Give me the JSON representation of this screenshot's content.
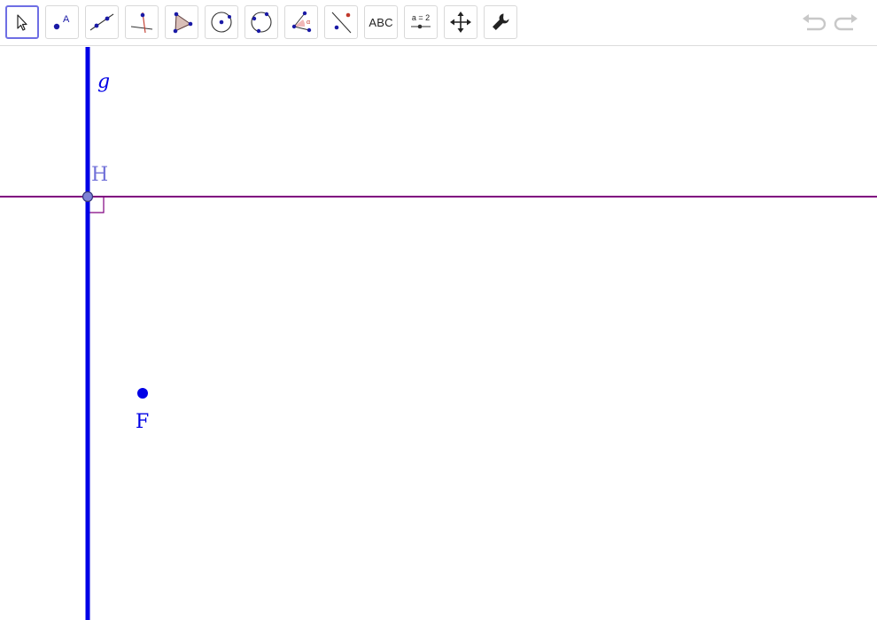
{
  "toolbar": {
    "tools": [
      {
        "name": "move-tool",
        "selected": true
      },
      {
        "name": "point-tool"
      },
      {
        "name": "line-tool"
      },
      {
        "name": "perpendicular-line-tool"
      },
      {
        "name": "polygon-tool"
      },
      {
        "name": "circle-with-center-tool"
      },
      {
        "name": "circle-through-3-points-tool"
      },
      {
        "name": "angle-tool"
      },
      {
        "name": "reflect-about-line-tool"
      },
      {
        "name": "text-tool",
        "label": "ABC"
      },
      {
        "name": "slider-tool",
        "label": "a = 2"
      },
      {
        "name": "move-graphics-view-tool"
      },
      {
        "name": "settings-tool"
      }
    ],
    "undo": {
      "icon": "undo-icon",
      "enabled": false
    },
    "redo": {
      "icon": "redo-icon",
      "enabled": false
    }
  },
  "construction": {
    "line_g": {
      "label": "g",
      "color": "#0000e6"
    },
    "perpendicular_line": {
      "color": "#800080"
    },
    "point_H": {
      "label": "H",
      "color": "#7070d8"
    },
    "point_F": {
      "label": "F",
      "color": "#0000e6"
    },
    "right_angle_marker": {
      "color": "#800080"
    }
  }
}
